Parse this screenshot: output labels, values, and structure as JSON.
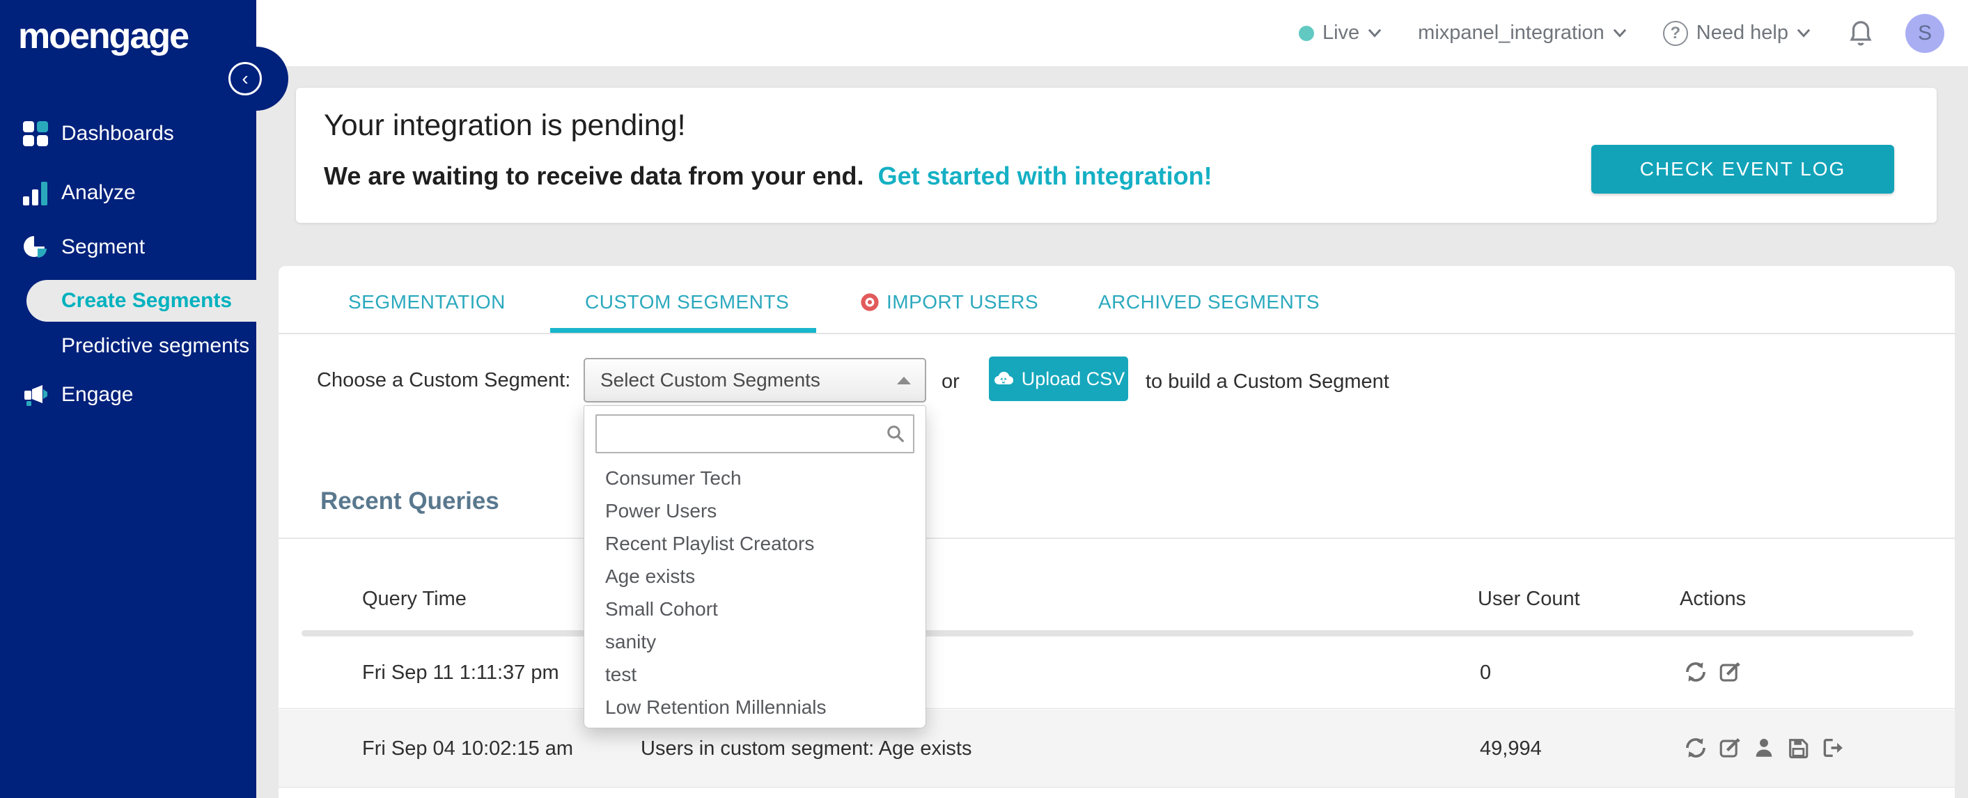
{
  "app": {
    "logo_text": "moengage"
  },
  "sidebar": {
    "items": [
      {
        "label": "Dashboards"
      },
      {
        "label": "Analyze"
      },
      {
        "label": "Segment"
      },
      {
        "label": "Create Segments"
      },
      {
        "label": "Predictive segments"
      },
      {
        "label": "Engage"
      }
    ]
  },
  "header": {
    "env_label": "Live",
    "workspace_name": "mixpanel_integration",
    "help_label": "Need help",
    "help_glyph": "?",
    "avatar_initial": "S"
  },
  "banner": {
    "title": "Your integration is pending!",
    "subtitle": "We are waiting to receive data from your end.",
    "link_label": "Get started with integration!",
    "button_label": "CHECK EVENT LOG"
  },
  "tabs": [
    {
      "label": "SEGMENTATION"
    },
    {
      "label": "CUSTOM SEGMENTS"
    },
    {
      "label": "IMPORT USERS"
    },
    {
      "label": "ARCHIVED SEGMENTS"
    }
  ],
  "segment_chooser": {
    "label": "Choose a Custom Segment:",
    "select_value": "Select Custom Segments",
    "or_text": "or",
    "upload_button_label": "Upload CSV",
    "suffix_text": "to build a Custom Segment",
    "search_value": "",
    "dropdown_items": [
      "Consumer Tech",
      "Power Users",
      "Recent Playlist Creators",
      "Age exists",
      "Small Cohort",
      "sanity",
      "test",
      "Low Retention Millennials"
    ]
  },
  "recent_queries": {
    "title": "Recent Queries",
    "columns": [
      "Query Time",
      "User Count",
      "Actions"
    ],
    "rows": [
      {
        "query_time": "Fri Sep 11 1:11:37 pm",
        "query": "",
        "user_count": "0"
      },
      {
        "query_time": "Fri Sep 04 10:02:15 am",
        "query": "Users in custom segment: Age exists",
        "user_count": "49,994"
      }
    ]
  },
  "colors": {
    "sidebar_navy": "#00217c",
    "accent_teal": "#16a7bc",
    "tab_teal": "#2ba9be",
    "link_teal": "#15b0c4",
    "heading_slate": "#59788e",
    "alert_red": "#e25a5a",
    "live_dot_teal": "#61c9c1",
    "avatar_purple": "#a9aef3",
    "row_alt_gray": "#f4f4f4",
    "page_bg": "#e9e9e9"
  }
}
